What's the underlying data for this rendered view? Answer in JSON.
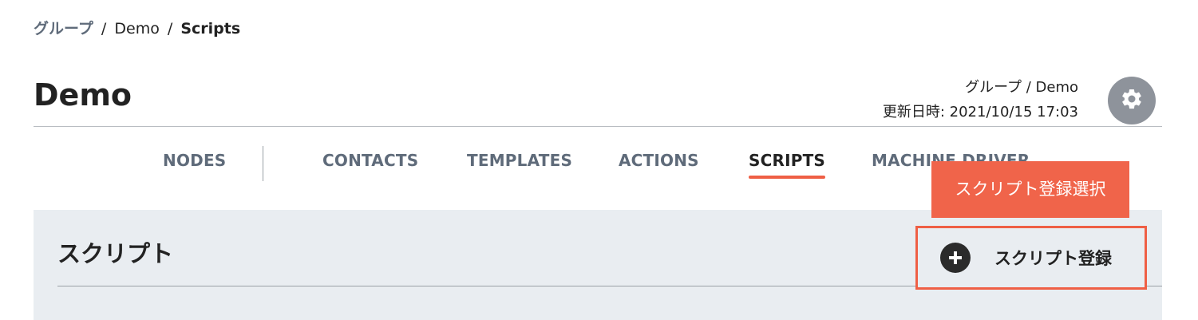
{
  "breadcrumb": {
    "group_link": "グループ",
    "separator": "/",
    "project": "Demo",
    "current": "Scripts"
  },
  "header": {
    "title": "Demo",
    "group_path": "グループ / Demo",
    "updated_at": "更新日時: 2021/10/15 17:03",
    "settings_icon": "gear-icon"
  },
  "tabs": [
    {
      "label": "NODES",
      "active": false
    },
    {
      "label": "CONTACTS",
      "active": false
    },
    {
      "label": "TEMPLATES",
      "active": false
    },
    {
      "label": "ACTIONS",
      "active": false
    },
    {
      "label": "SCRIPTS",
      "active": true
    },
    {
      "label": "MACHINE DRIVER",
      "active": false
    }
  ],
  "panel": {
    "title": "スクリプト",
    "register_button_label": "スクリプト登録",
    "register_icon": "plus-circle-icon"
  },
  "tooltip": {
    "text": "スクリプト登録選択"
  },
  "colors": {
    "accent": "#ef5f45",
    "tooltip_bg": "#f0644a",
    "panel_bg": "#e9edf1",
    "muted_text": "#5f6b7a"
  }
}
